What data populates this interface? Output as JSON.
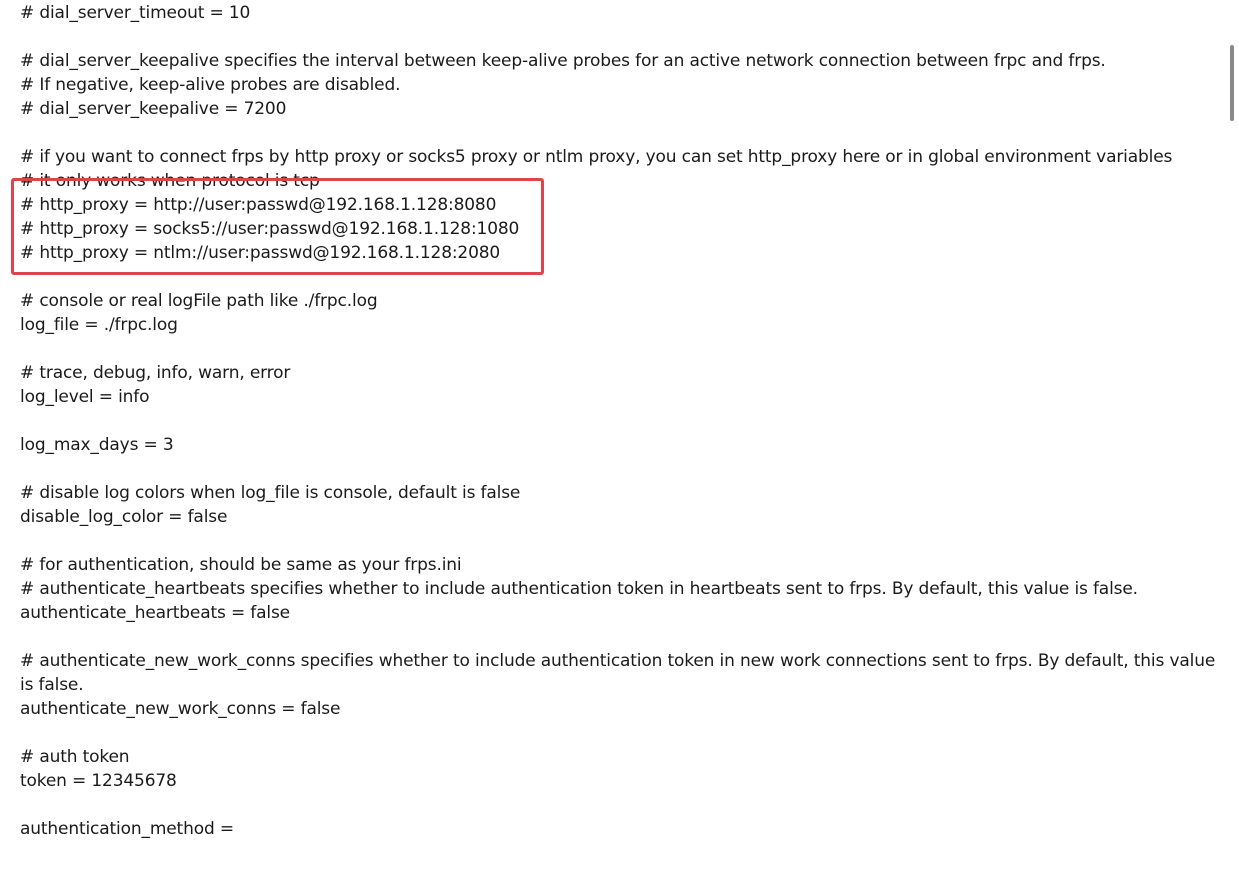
{
  "editor": {
    "lines": [
      "# dial_server_timeout = 10",
      "",
      "# dial_server_keepalive specifies the interval between keep-alive probes for an active network connection between frpc and frps.",
      "# If negative, keep-alive probes are disabled.",
      "# dial_server_keepalive = 7200",
      "",
      "# if you want to connect frps by http proxy or socks5 proxy or ntlm proxy, you can set http_proxy here or in global environment variables",
      "# it only works when protocol is tcp",
      "# http_proxy = http://user:passwd@192.168.1.128:8080",
      "# http_proxy = socks5://user:passwd@192.168.1.128:1080",
      "# http_proxy = ntlm://user:passwd@192.168.1.128:2080",
      "",
      "# console or real logFile path like ./frpc.log",
      "log_file = ./frpc.log",
      "",
      "# trace, debug, info, warn, error",
      "log_level = info",
      "",
      "log_max_days = 3",
      "",
      "# disable log colors when log_file is console, default is false",
      "disable_log_color = false",
      "",
      "# for authentication, should be same as your frps.ini",
      "# authenticate_heartbeats specifies whether to include authentication token in heartbeats sent to frps. By default, this value is false.",
      "authenticate_heartbeats = false",
      "",
      "# authenticate_new_work_conns specifies whether to include authentication token in new work connections sent to frps. By default, this value is false.",
      "authenticate_new_work_conns = false",
      "",
      "# auth token",
      "token = 12345678",
      "",
      "authentication_method ="
    ]
  },
  "highlight": {
    "color": "#e0434d"
  }
}
